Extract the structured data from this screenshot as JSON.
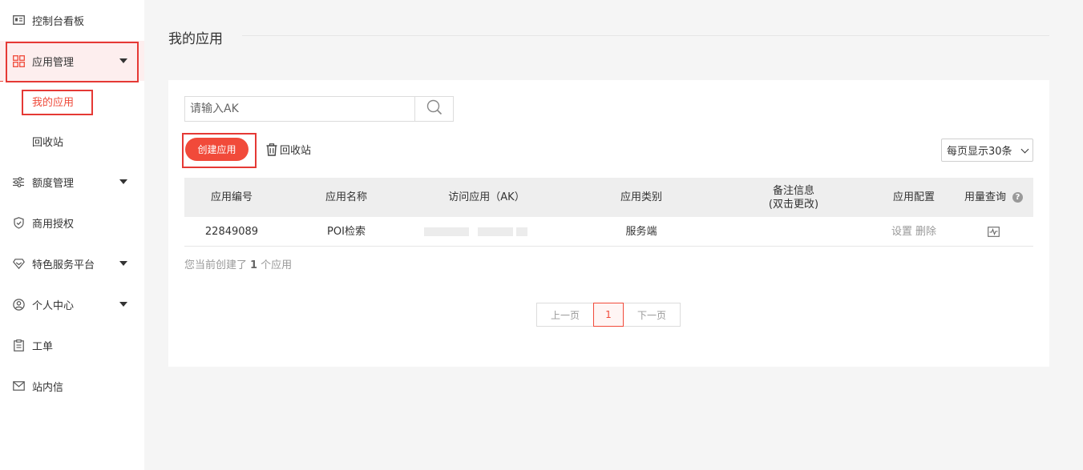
{
  "sidebar": {
    "items": [
      {
        "label": "控制台看板",
        "icon": "dashboard-card-icon"
      },
      {
        "label": "应用管理",
        "icon": "grid-apps-icon"
      },
      {
        "label": "额度管理",
        "icon": "sliders-icon"
      },
      {
        "label": "商用授权",
        "icon": "shield-check-icon"
      },
      {
        "label": "特色服务平台",
        "icon": "diamond-icon"
      },
      {
        "label": "个人中心",
        "icon": "user-circle-icon"
      },
      {
        "label": "工单",
        "icon": "clipboard-icon"
      },
      {
        "label": "站内信",
        "icon": "mail-icon"
      }
    ],
    "sub_items": [
      {
        "label": "我的应用"
      },
      {
        "label": "回收站"
      }
    ],
    "accent": "#ef4a3a"
  },
  "header": {
    "title": "我的应用"
  },
  "toolbar": {
    "search_placeholder": "请输入AK",
    "create_label": "创建应用",
    "recycle_label": "回收站",
    "page_size_label": "每页显示30条"
  },
  "table": {
    "headers": [
      "应用编号",
      "应用名称",
      "访问应用（AK）",
      "应用类别",
      "备注信息\n(双击更改)",
      "应用配置",
      "用量查询"
    ],
    "header_note_line1": "备注信息",
    "header_note_line2": "(双击更改)",
    "rows": [
      {
        "id": "22849089",
        "name": "POI检索",
        "category": "服务端",
        "note": "",
        "config_set": "设置",
        "config_delete": "删除"
      }
    ]
  },
  "summary": {
    "prefix": "您当前创建了",
    "count": "1",
    "suffix": "个应用"
  },
  "pagination": {
    "prev": "上一页",
    "current": "1",
    "next": "下一页"
  }
}
